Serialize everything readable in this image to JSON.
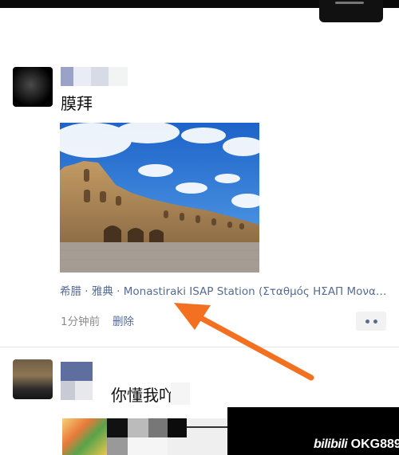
{
  "post1": {
    "text": "膜拜",
    "location": "希腊 · 雅典 · Monastiraki ISAP Station (Σταθμός ΗΣΑΠ Μονα…",
    "time": "1分钟前",
    "delete_label": "删除"
  },
  "post2": {
    "text": "你懂我吖"
  },
  "watermark": {
    "brand": "bilibili",
    "handle": "OKG889"
  },
  "colors": {
    "link": "#576b95",
    "arrow": "#f37021",
    "time": "#8a8a8a"
  },
  "icons": {
    "more": "two-dots-icon",
    "arrow": "orange-arrow"
  }
}
